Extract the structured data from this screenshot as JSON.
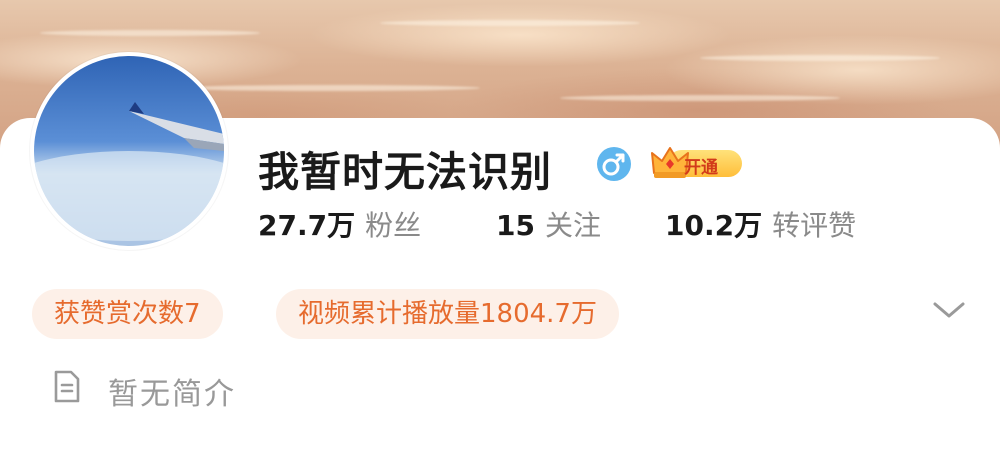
{
  "profile": {
    "name": "我暂时无法识别",
    "gender_icon": "male-icon",
    "vip_badge": "开通"
  },
  "stats": [
    {
      "value": "27.7万",
      "label": "粉丝"
    },
    {
      "value": "15",
      "label": "关注"
    },
    {
      "value": "10.2万",
      "label": "转评赞"
    }
  ],
  "tags": [
    "获赞赏次数7",
    "视频累计播放量1804.7万"
  ],
  "bio": {
    "icon": "document-icon",
    "text": "暂无简介"
  },
  "colors": {
    "tag_text": "#e66b2e",
    "tag_bg": "#fdf0e8",
    "gender_badge": "#5fb6ee",
    "vip_gold": "#ffbe3a"
  }
}
